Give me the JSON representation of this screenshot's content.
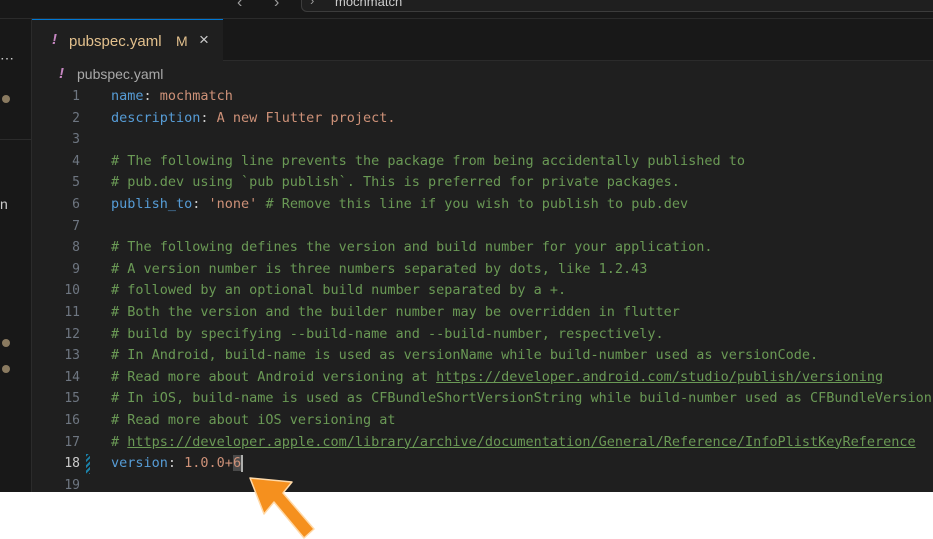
{
  "titlebar": {
    "back_glyph": "‹",
    "forward_glyph": "›",
    "search_chevron": "›",
    "command_center_text": "mochmatch"
  },
  "sidebar": {
    "more_glyph": "⋯",
    "letter": "n"
  },
  "tab": {
    "icon_glyph": "!",
    "label": "pubspec.yaml",
    "modified_marker": "M",
    "close_glyph": "×"
  },
  "breadcrumb": {
    "icon_glyph": "!",
    "label": "pubspec.yaml"
  },
  "editor": {
    "active_line": 18,
    "line_numbers": [
      "1",
      "2",
      "3",
      "4",
      "5",
      "6",
      "7",
      "8",
      "9",
      "10",
      "11",
      "12",
      "13",
      "14",
      "15",
      "16",
      "17",
      "18",
      "19"
    ],
    "lines": {
      "l1_key": "name",
      "l1_colon": ": ",
      "l1_val": "mochmatch",
      "l2_key": "description",
      "l2_colon": ": ",
      "l2_val": "A new Flutter project.",
      "l4": "# The following line prevents the package from being accidentally published to",
      "l5": "# pub.dev using `pub publish`. This is preferred for private packages.",
      "l6_key": "publish_to",
      "l6_colon": ": ",
      "l6_val": "'none'",
      "l6_comment": " # Remove this line if you wish to publish to pub.dev",
      "l8": "# The following defines the version and build number for your application.",
      "l9": "# A version number is three numbers separated by dots, like 1.2.43",
      "l10": "# followed by an optional build number separated by a +.",
      "l11": "# Both the version and the builder number may be overridden in flutter",
      "l12": "# build by specifying --build-name and --build-number, respectively.",
      "l13": "# In Android, build-name is used as versionName while build-number used as versionCode.",
      "l14_prefix": "# Read more about Android versioning at ",
      "l14_link": "https://developer.android.com/studio/publish/versioning",
      "l15": "# In iOS, build-name is used as CFBundleShortVersionString while build-number used as CFBundleVersion.",
      "l16": "# Read more about iOS versioning at",
      "l17_prefix": "# ",
      "l17_link": "https://developer.apple.com/library/archive/documentation/General/Reference/InfoPlistKeyReference",
      "l18_key": "version",
      "l18_colon": ": ",
      "l18_val": "1.0.0+",
      "l18_selected": "6"
    }
  },
  "colors": {
    "key": "#569cd6",
    "string": "#ce9178",
    "comment": "#6a9955",
    "modified": "#e2c08d",
    "yaml_icon": "#c586c0",
    "annotation_arrow": "#f5901e"
  }
}
